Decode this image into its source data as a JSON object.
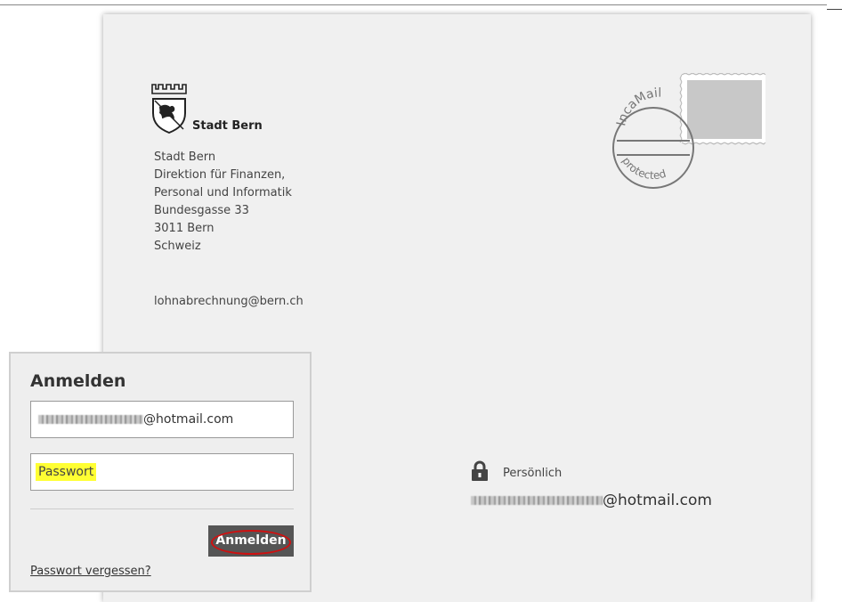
{
  "sender": {
    "brand_name": "Stadt Bern",
    "address_lines": [
      "Stadt Bern",
      "Direktion für Finanzen,",
      "Personal und Informatik",
      "Bundesgasse 33",
      "3011 Bern",
      "Schweiz"
    ],
    "email": "lohnabrechnung@bern.ch"
  },
  "postmark": {
    "top_text": "IncaMail",
    "bottom_text": "protected"
  },
  "recipient": {
    "label": "Persönlich",
    "email_suffix": "@hotmail.com"
  },
  "login": {
    "title": "Anmelden",
    "email_suffix": "@hotmail.com",
    "password_placeholder": "Passwort",
    "submit_label": "Anmelden",
    "forgot_link": "Passwort vergessen?"
  },
  "colors": {
    "button_bg": "#555555",
    "highlight": "#ffff33",
    "annotation_ring": "#d01010"
  }
}
